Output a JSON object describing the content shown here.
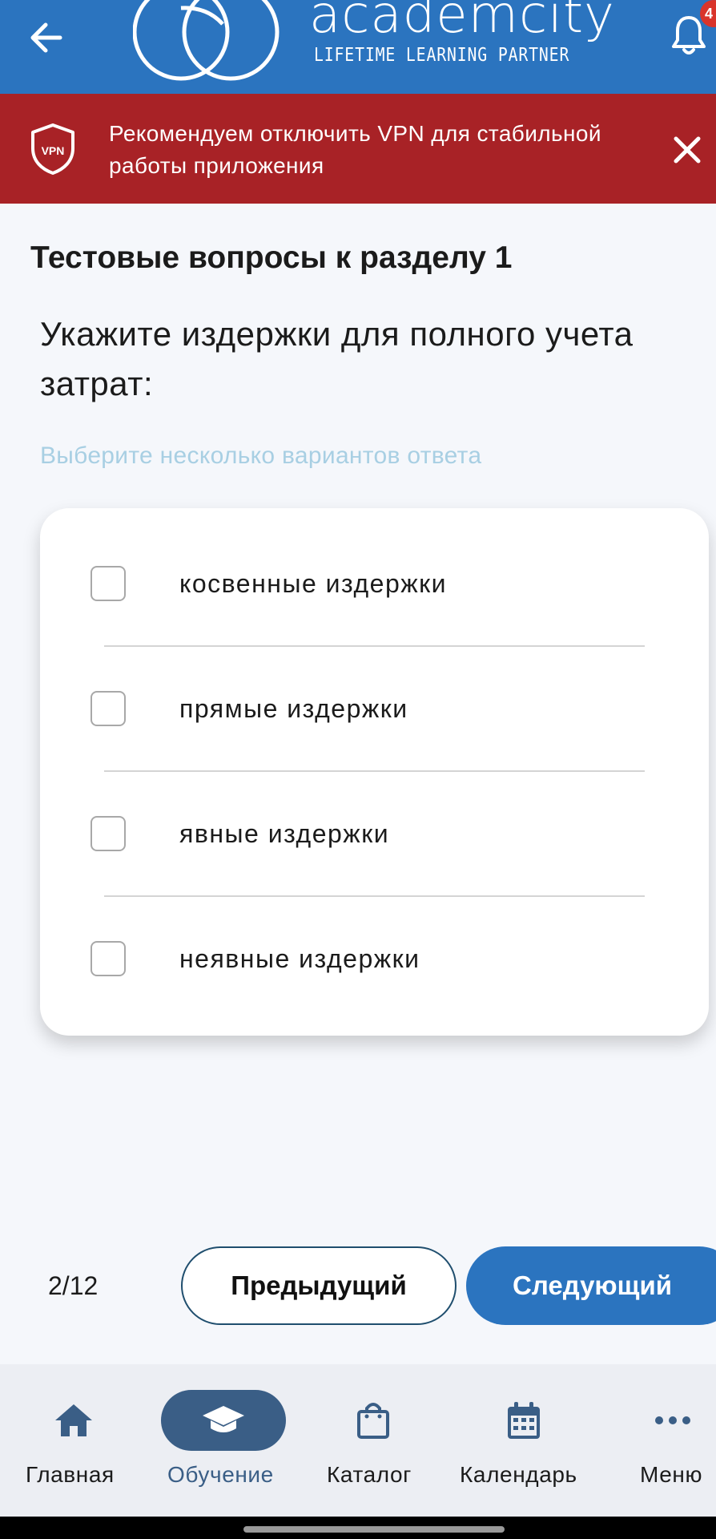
{
  "header": {
    "logo_word": "academcity",
    "logo_tagline": "LIFETIME LEARNING PARTNER",
    "notification_count": "4",
    "brand_color": "#2b74bf"
  },
  "banner": {
    "icon_text": "VPN",
    "text": "Рекомендуем отключить VPN для стабильной работы приложения",
    "color": "#a82226"
  },
  "quiz": {
    "section_title": "Тестовые вопросы к разделу 1",
    "question": "Укажите издержки для полного учета затрат:",
    "hint": "Выберите несколько вариантов ответа",
    "options": [
      {
        "label": "косвенные издержки",
        "checked": false
      },
      {
        "label": "прямые издержки",
        "checked": false
      },
      {
        "label": "явные издержки",
        "checked": false
      },
      {
        "label": "неявные издержки",
        "checked": false
      }
    ]
  },
  "pager": {
    "counter": "2/12",
    "prev_label": "Предыдущий",
    "next_label": "Следующий"
  },
  "nav": {
    "items": [
      {
        "label": "Главная",
        "icon": "home-icon",
        "active": false
      },
      {
        "label": "Обучение",
        "icon": "graduation-cap-icon",
        "active": true
      },
      {
        "label": "Каталог",
        "icon": "shopping-bag-icon",
        "active": false
      },
      {
        "label": "Календарь",
        "icon": "calendar-icon",
        "active": false
      },
      {
        "label": "Меню",
        "icon": "more-dots-icon",
        "active": false
      }
    ]
  }
}
